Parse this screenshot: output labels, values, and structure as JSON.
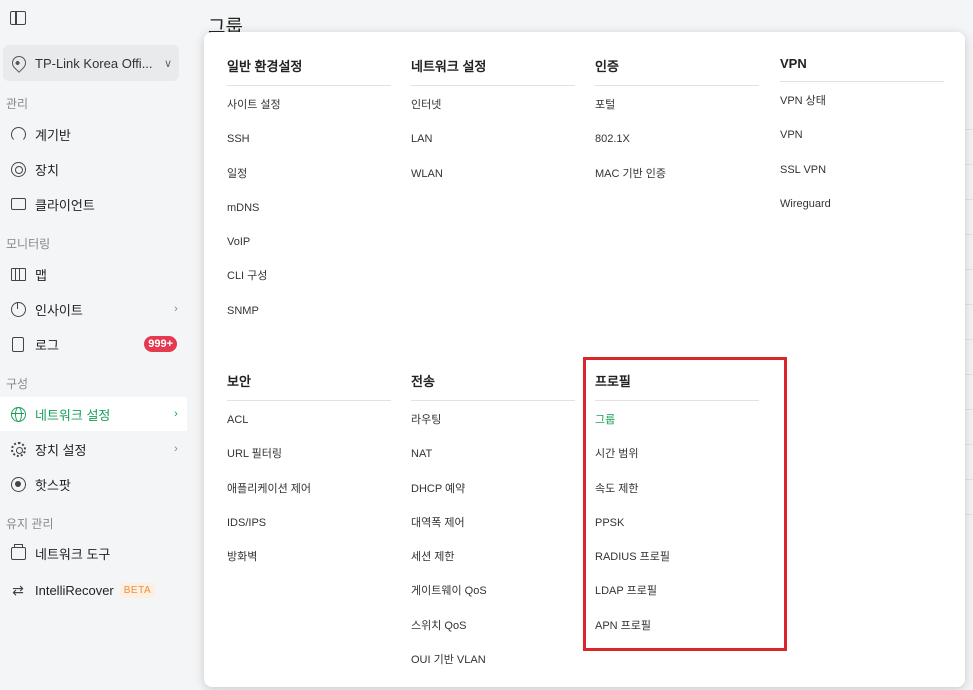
{
  "sidebar": {
    "site": "TP-Link Korea Offi...",
    "sections": {
      "manage": "관리",
      "monitor": "모니터링",
      "config": "구성",
      "maint": "유지 관리"
    },
    "items": {
      "dashboard": "계기반",
      "devices": "장치",
      "clients": "클라이언트",
      "map": "맵",
      "insight": "인사이트",
      "logs": "로그",
      "logs_badge": "999+",
      "network": "네트워크 설정",
      "device_settings": "장치 설정",
      "hotspot": "핫스팟",
      "tools": "네트워크 도구",
      "intellirecover": "IntelliRecover",
      "beta": "BETA"
    }
  },
  "main": {
    "title": "그룹"
  },
  "menu": {
    "general": {
      "header": "일반 환경설정",
      "items": [
        "사이트 설정",
        "SSH",
        "일정",
        "mDNS",
        "VoIP",
        "CLI 구성",
        "SNMP"
      ]
    },
    "network": {
      "header": "네트워크 설정",
      "items": [
        "인터넷",
        "LAN",
        "WLAN"
      ]
    },
    "auth": {
      "header": "인증",
      "items": [
        "포털",
        "802.1X",
        "MAC 기반 인증"
      ]
    },
    "vpn": {
      "header": "VPN",
      "items": [
        "VPN 상태",
        "VPN",
        "SSL VPN",
        "Wireguard"
      ]
    },
    "security": {
      "header": "보안",
      "items": [
        "ACL",
        "URL 필터링",
        "애플리케이션 제어",
        "IDS/IPS",
        "방화벽"
      ]
    },
    "transmission": {
      "header": "전송",
      "items": [
        "라우팅",
        "NAT",
        "DHCP 예약",
        "대역폭 제어",
        "세션 제한",
        "게이트웨이 QoS",
        "스위치 QoS",
        "OUI 기반 VLAN"
      ]
    },
    "profile": {
      "header": "프로필",
      "items": [
        "그룹",
        "시간 범위",
        "속도 제한",
        "PPSK",
        "RADIUS 프로필",
        "LDAP 프로필",
        "APN 프로필"
      ]
    }
  },
  "colors": {
    "accent": "#18a058",
    "badge": "#e53950",
    "highlight": "#d9262c"
  }
}
